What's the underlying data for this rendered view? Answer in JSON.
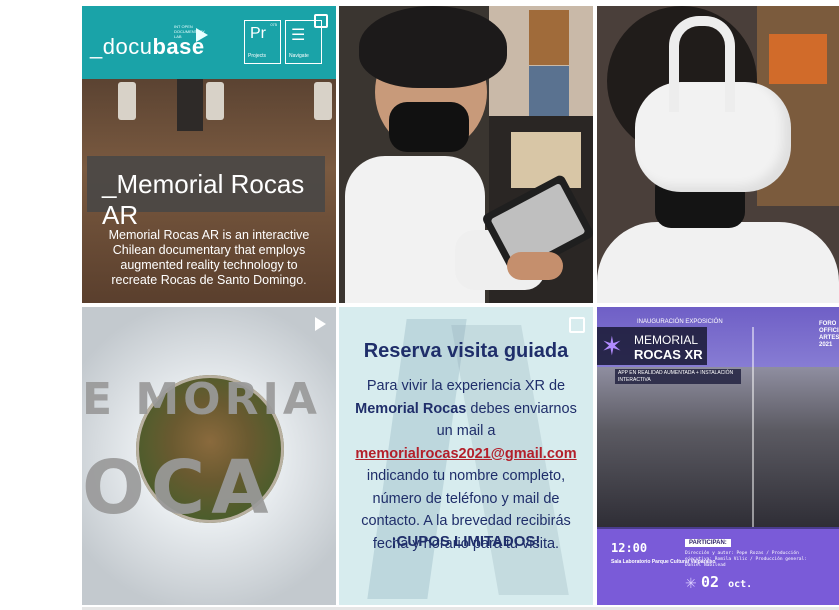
{
  "grid": {
    "posts": [
      {
        "logo_light": "_docu",
        "logo_bold": "base",
        "logo_small": "INT OPEN DOCUMENTARY LAB",
        "tile_a_big": "Pr",
        "tile_a_label": "Projects",
        "tile_a_num": "075",
        "tile_b_label": "Navigate",
        "title": "_Memorial Rocas AR",
        "description": "Memorial Rocas AR is an interactive Chilean documentary that employs augmented reality technology to recreate Rocas de Santo Domingo."
      },
      {},
      {},
      {
        "word1": "E MORIA",
        "word2": "OCA",
        "icon": "play-icon"
      },
      {
        "title": "Reserva visita guiada",
        "body_1": "Para vivir la experiencia XR de",
        "body_em": "Memorial Rocas",
        "body_2": "debes enviarnos un mail a",
        "email": "memorialrocas2021@gmail.com",
        "body_3": "indicando tu nombre completo, número de teléfono y mail de contacto. A la brevedad recibirás fecha y horario para tu visita.",
        "footer": "¡CUPOS LIMITADOS!",
        "icon": "gallery-icon"
      },
      {
        "top_label": "INAUGURACIÓN EXPOSICIÓN",
        "logo_line1": "MEMORIAL",
        "logo_line2": "ROCAS XR",
        "subtitle": "APP EN REALIDAD AUMENTADA + INSTALACIÓN INTERACTIVA",
        "side_text": "FORO OFFICIAL ARTES 2021",
        "time": "12:00",
        "place": "Sala Laboratorio Parque Cultural Valparaíso",
        "participan_label": "PARTICIPAN:",
        "participants": "Dirección y autor: Pepe Rozas / Producción ejecutiva: Romila Vilic / Producción general: Daniel Nabilead",
        "date_day": "02",
        "date_month": "oct."
      }
    ]
  }
}
